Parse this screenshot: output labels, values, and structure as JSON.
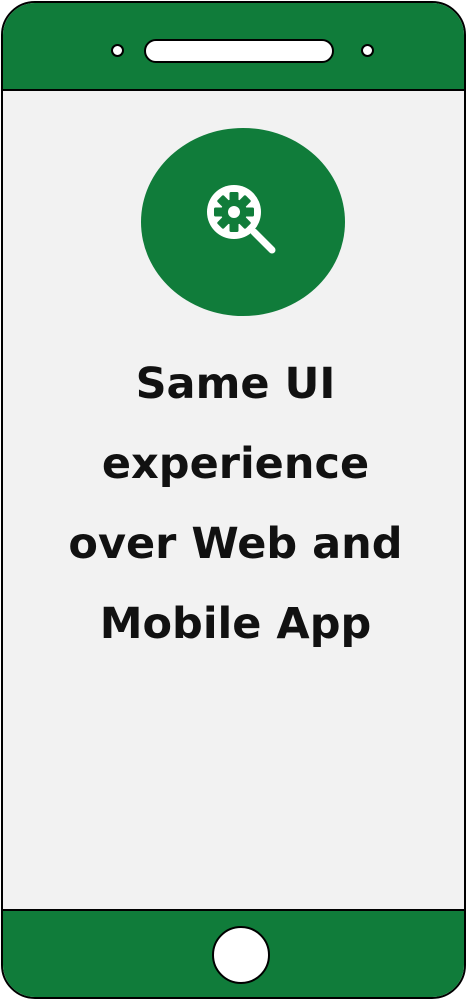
{
  "illustration": {
    "headline_lines": [
      "Same UI",
      "experience",
      "over Web and",
      "Mobile App"
    ],
    "icon": "gear-search-icon",
    "colors": {
      "brand_green": "#107c3a",
      "screen_background": "#f2f2f2",
      "outline": "#000000",
      "icon_foreground": "#ffffff"
    }
  }
}
